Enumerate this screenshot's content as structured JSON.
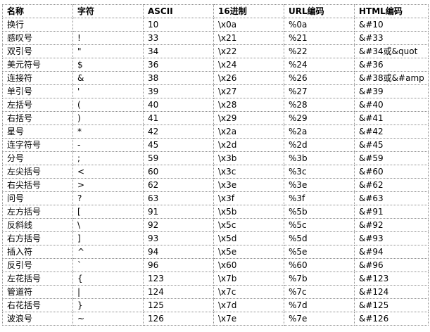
{
  "table": {
    "headers": [
      "名称",
      "字符",
      "ASCII",
      "16进制",
      "URL编码",
      "HTML编码"
    ],
    "rows": [
      [
        "换行",
        "",
        "10",
        "\\x0a",
        "%0a",
        "&#10"
      ],
      [
        "感叹号",
        "!",
        "33",
        "\\x21",
        "%21",
        "&#33"
      ],
      [
        "双引号",
        "\"",
        "34",
        "\\x22",
        "%22",
        "&#34或&quot"
      ],
      [
        "美元符号",
        "$",
        "36",
        "\\x24",
        "%24",
        "&#36"
      ],
      [
        "连接符",
        "&",
        "38",
        "\\x26",
        "%26",
        "&#38或&#amp"
      ],
      [
        "单引号",
        "'",
        "39",
        "\\x27",
        "%27",
        "&#39"
      ],
      [
        "左括号",
        "(",
        "40",
        "\\x28",
        "%28",
        "&#40"
      ],
      [
        "右括号",
        ")",
        "41",
        "\\x29",
        "%29",
        "&#41"
      ],
      [
        "星号",
        "*",
        "42",
        "\\x2a",
        "%2a",
        "&#42"
      ],
      [
        "连字符号",
        "-",
        "45",
        "\\x2d",
        "%2d",
        "&#45"
      ],
      [
        "分号",
        ";",
        "59",
        "\\x3b",
        "%3b",
        "&#59"
      ],
      [
        "左尖括号",
        "<",
        "60",
        "\\x3c",
        "%3c",
        "&#60"
      ],
      [
        "右尖括号",
        ">",
        "62",
        "\\x3e",
        "%3e",
        "&#62"
      ],
      [
        "问号",
        "?",
        "63",
        "\\x3f",
        "%3f",
        "&#63"
      ],
      [
        "左方括号",
        "[",
        "91",
        "\\x5b",
        "%5b",
        "&#91"
      ],
      [
        "反斜线",
        "\\",
        "92",
        "\\x5c",
        "%5c",
        "&#92"
      ],
      [
        "右方括号",
        "]",
        "93",
        "\\x5d",
        "%5d",
        "&#93"
      ],
      [
        "插入符",
        "^",
        "94",
        "\\x5e",
        "%5e",
        "&#94"
      ],
      [
        "反引号",
        "`",
        "96",
        "\\x60",
        "%60",
        "&#96"
      ],
      [
        "左花括号",
        "{",
        "123",
        "\\x7b",
        "%7b",
        "&#123"
      ],
      [
        "管道符",
        "|",
        "124",
        "\\x7c",
        "%7c",
        "&#124"
      ],
      [
        "右花括号",
        "}",
        "125",
        "\\x7d",
        "%7d",
        "&#125"
      ],
      [
        "波浪号",
        "~",
        "126",
        "\\x7e",
        "%7e",
        "&#126"
      ]
    ]
  }
}
